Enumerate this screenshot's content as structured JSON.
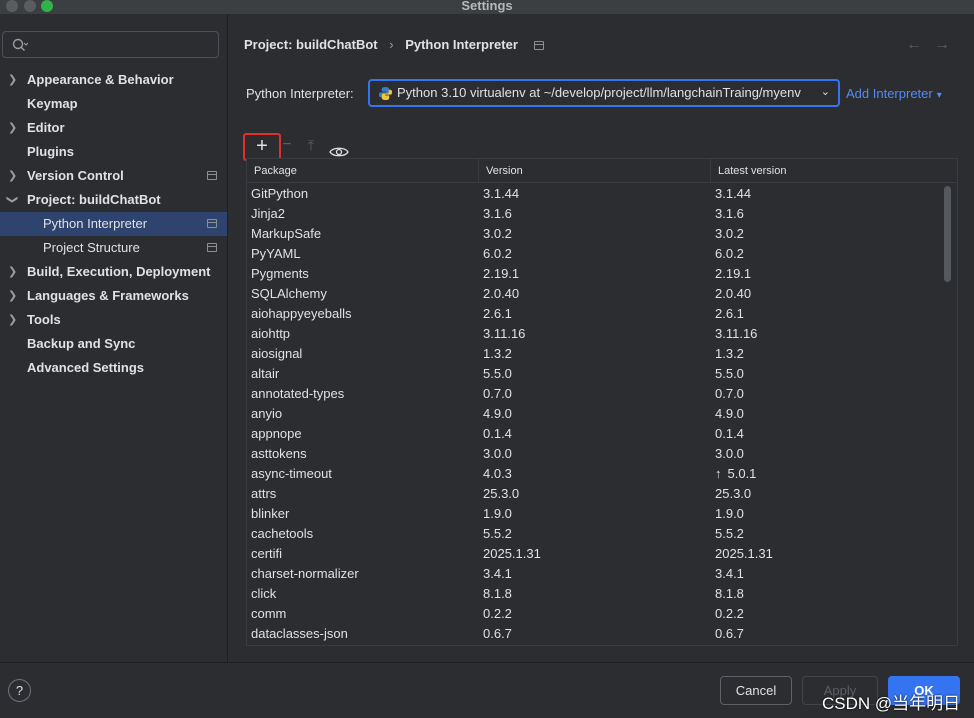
{
  "window": {
    "title": "Settings"
  },
  "sidebar": {
    "search_placeholder": "",
    "items": [
      {
        "label": "Appearance & Behavior"
      },
      {
        "label": "Keymap"
      },
      {
        "label": "Editor"
      },
      {
        "label": "Plugins"
      },
      {
        "label": "Version Control"
      },
      {
        "label": "Project: buildChatBot"
      },
      {
        "label": "Python Interpreter"
      },
      {
        "label": "Project Structure"
      },
      {
        "label": "Build, Execution, Deployment"
      },
      {
        "label": "Languages & Frameworks"
      },
      {
        "label": "Tools"
      },
      {
        "label": "Backup and Sync"
      },
      {
        "label": "Advanced Settings"
      }
    ]
  },
  "breadcrumb": {
    "project": "Project: buildChatBot",
    "separator": "›",
    "page": "Python Interpreter"
  },
  "nav": {
    "back": "←",
    "forward": "→"
  },
  "interpreter": {
    "label": "Python Interpreter:",
    "value": "Python 3.10 virtualenv at ~/develop/project/llm/langchainTraing/myenv",
    "add_label": "Add Interpreter",
    "add_caret": "▾",
    "chevron": "⌄"
  },
  "toolbar": {
    "add": "+",
    "remove": "−",
    "upgrade": "⤒"
  },
  "table": {
    "headers": {
      "package": "Package",
      "version": "Version",
      "latest": "Latest version"
    },
    "upgrade_marker": "↑",
    "rows": [
      {
        "package": "GitPython",
        "version": "3.1.44",
        "latest": "3.1.44"
      },
      {
        "package": "Jinja2",
        "version": "3.1.6",
        "latest": "3.1.6"
      },
      {
        "package": "MarkupSafe",
        "version": "3.0.2",
        "latest": "3.0.2"
      },
      {
        "package": "PyYAML",
        "version": "6.0.2",
        "latest": "6.0.2"
      },
      {
        "package": "Pygments",
        "version": "2.19.1",
        "latest": "2.19.1"
      },
      {
        "package": "SQLAlchemy",
        "version": "2.0.40",
        "latest": "2.0.40"
      },
      {
        "package": "aiohappyeyeballs",
        "version": "2.6.1",
        "latest": "2.6.1"
      },
      {
        "package": "aiohttp",
        "version": "3.11.16",
        "latest": "3.11.16"
      },
      {
        "package": "aiosignal",
        "version": "1.3.2",
        "latest": "1.3.2"
      },
      {
        "package": "altair",
        "version": "5.5.0",
        "latest": "5.5.0"
      },
      {
        "package": "annotated-types",
        "version": "0.7.0",
        "latest": "0.7.0"
      },
      {
        "package": "anyio",
        "version": "4.9.0",
        "latest": "4.9.0"
      },
      {
        "package": "appnope",
        "version": "0.1.4",
        "latest": "0.1.4"
      },
      {
        "package": "asttokens",
        "version": "3.0.0",
        "latest": "3.0.0"
      },
      {
        "package": "async-timeout",
        "version": "4.0.3",
        "latest": "5.0.1",
        "upgrade": true
      },
      {
        "package": "attrs",
        "version": "25.3.0",
        "latest": "25.3.0"
      },
      {
        "package": "blinker",
        "version": "1.9.0",
        "latest": "1.9.0"
      },
      {
        "package": "cachetools",
        "version": "5.5.2",
        "latest": "5.5.2"
      },
      {
        "package": "certifi",
        "version": "2025.1.31",
        "latest": "2025.1.31"
      },
      {
        "package": "charset-normalizer",
        "version": "3.4.1",
        "latest": "3.4.1"
      },
      {
        "package": "click",
        "version": "8.1.8",
        "latest": "8.1.8"
      },
      {
        "package": "comm",
        "version": "0.2.2",
        "latest": "0.2.2"
      },
      {
        "package": "dataclasses-json",
        "version": "0.6.7",
        "latest": "0.6.7"
      }
    ]
  },
  "footer": {
    "help": "?",
    "cancel": "Cancel",
    "apply": "Apply",
    "ok": "OK",
    "watermark": "CSDN @当年明日"
  },
  "colors": {
    "accent": "#3574f0",
    "link": "#548af7",
    "highlight_box": "#e0302a",
    "selection": "#2e436e"
  }
}
